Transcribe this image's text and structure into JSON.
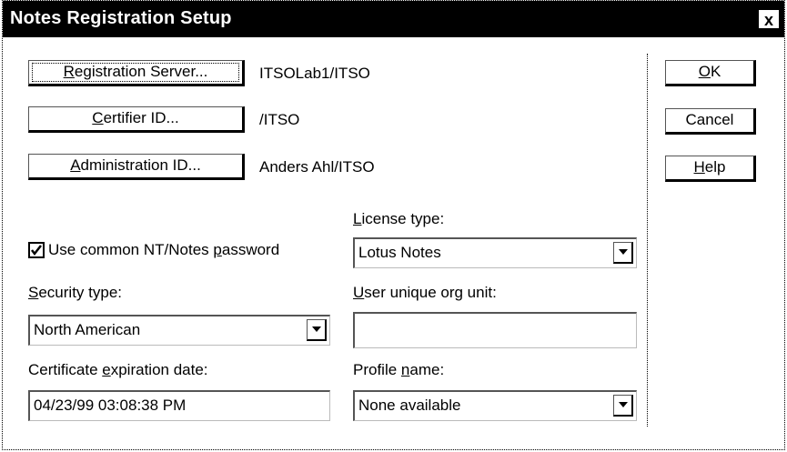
{
  "window": {
    "title": "Notes Registration Setup",
    "close_glyph": "x"
  },
  "buttons": {
    "registration_server": {
      "pre": "",
      "mn": "R",
      "post": "egistration Server..."
    },
    "certifier_id": {
      "pre": "",
      "mn": "C",
      "post": "ertifier ID..."
    },
    "administration_id": {
      "pre": "",
      "mn": "A",
      "post": "dministration ID..."
    },
    "ok": {
      "pre": "",
      "mn": "O",
      "post": "K"
    },
    "cancel": {
      "pre": "Cancel",
      "mn": "",
      "post": ""
    },
    "help": {
      "pre": "",
      "mn": "H",
      "post": "elp"
    }
  },
  "values": {
    "registration_server": "ITSOLab1/ITSO",
    "certifier_id": "/ITSO",
    "administration_id": "Anders Ahl/ITSO"
  },
  "checkbox": {
    "checked": true,
    "label_pre": "Use common NT/Notes ",
    "label_mn": "p",
    "label_post": "assword"
  },
  "security_type": {
    "label_mn": "S",
    "label_post": "ecurity type:",
    "value": "North American"
  },
  "certificate_expiration": {
    "label_pre": "Certificate ",
    "label_mn": "e",
    "label_post": "xpiration date:",
    "value": "04/23/99 03:08:38 PM"
  },
  "license_type": {
    "label_mn": "L",
    "label_post": "icense type:",
    "value": "Lotus Notes"
  },
  "user_unique_org_unit": {
    "label_mn": "U",
    "label_post": "ser unique org unit:",
    "value": ""
  },
  "profile_name": {
    "label_pre": "Profile ",
    "label_mn": "n",
    "label_post": "ame:",
    "value": "None available"
  },
  "icons": {
    "dropdown": "down-arrow-icon",
    "close": "close-icon",
    "check": "checkmark-icon"
  }
}
